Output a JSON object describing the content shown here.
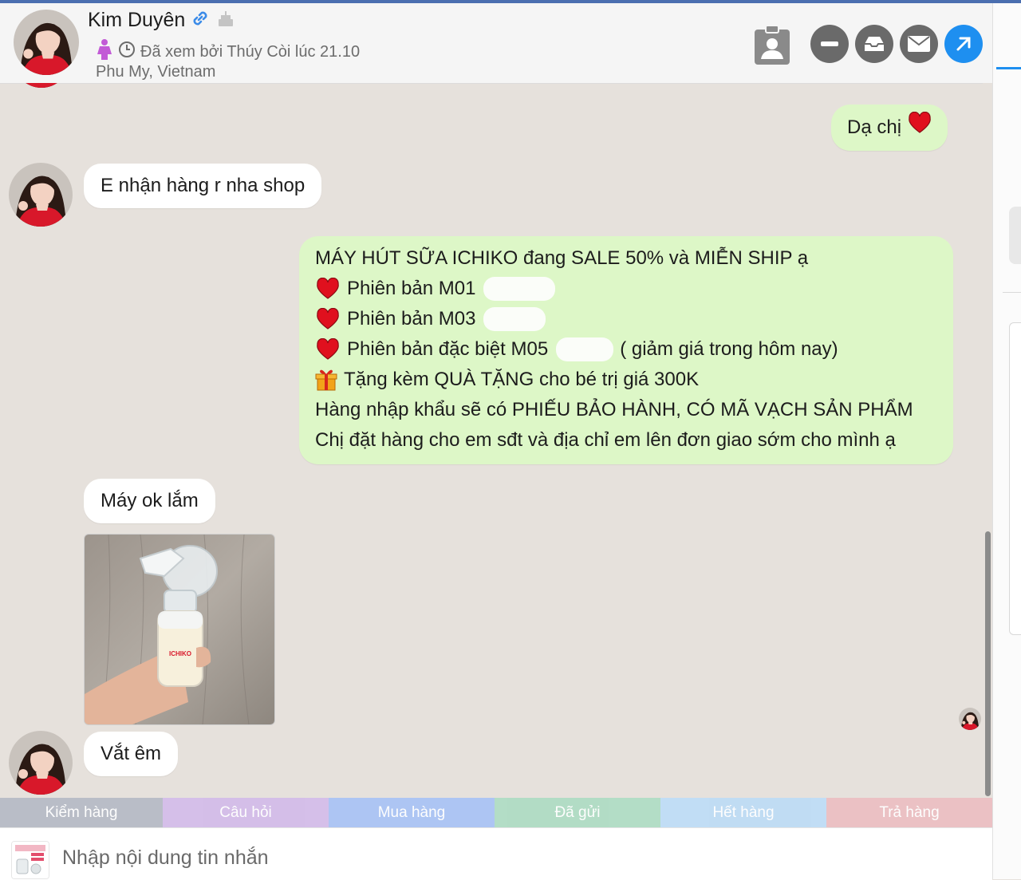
{
  "contact": {
    "name": "Kim Duyên",
    "seen_text": "Đã xem bởi Thúy Còi lúc 21.10",
    "location": "Phu My, Vietnam"
  },
  "header_actions": [
    {
      "name": "contact-card-button",
      "icon": "contact-card-icon"
    },
    {
      "name": "minimize-button",
      "icon": "minus-icon"
    },
    {
      "name": "archive-button",
      "icon": "inbox-icon"
    },
    {
      "name": "mail-button",
      "icon": "mail-icon"
    },
    {
      "name": "open-external-button",
      "icon": "arrow-up-right-icon"
    }
  ],
  "messages": {
    "out1": {
      "text": "Dạ chị"
    },
    "in1": {
      "text": "E nhận hàng r nha shop"
    },
    "out2": {
      "lines": [
        "MÁY HÚT SỮA ICHIKO đang SALE 50% và MIỄN SHIP ạ",
        "Phiên bản M01",
        "Phiên bản M03",
        "Phiên bản đặc biệt M05",
        "( giảm giá trong hôm nay)",
        "Tặng kèm QUÀ TẶNG cho bé trị giá 300K",
        "Hàng nhập khẩu sẽ có PHIẾU BẢO HÀNH, CÓ MÃ VẠCH SẢN PHẨM",
        "Chị đặt hàng cho em sđt và địa chỉ em lên đơn giao sớm cho mình ạ"
      ]
    },
    "in2": {
      "text": "Máy ok lắm"
    },
    "photo": {
      "brand": "ICHIKO"
    },
    "in3": {
      "text": "Vắt êm"
    }
  },
  "tags": [
    {
      "label": "Kiểm hàng",
      "color": "#b7bcc6"
    },
    {
      "label": "Câu hỏi",
      "color": "#d4bde9"
    },
    {
      "label": "Mua hàng",
      "color": "#abc4f5"
    },
    {
      "label": "Đã gửi",
      "color": "#b0dcc4"
    },
    {
      "label": "Hết hàng",
      "color": "#bfdcf5"
    },
    {
      "label": "Trả hàng",
      "color": "#ecc0c3"
    }
  ],
  "composer": {
    "placeholder": "Nhập nội dung tin nhắn"
  },
  "colors": {
    "accent": "#1e8ff0",
    "outgoing": "#ddf7c7",
    "incoming": "#ffffff",
    "background": "#e6e1dc"
  }
}
